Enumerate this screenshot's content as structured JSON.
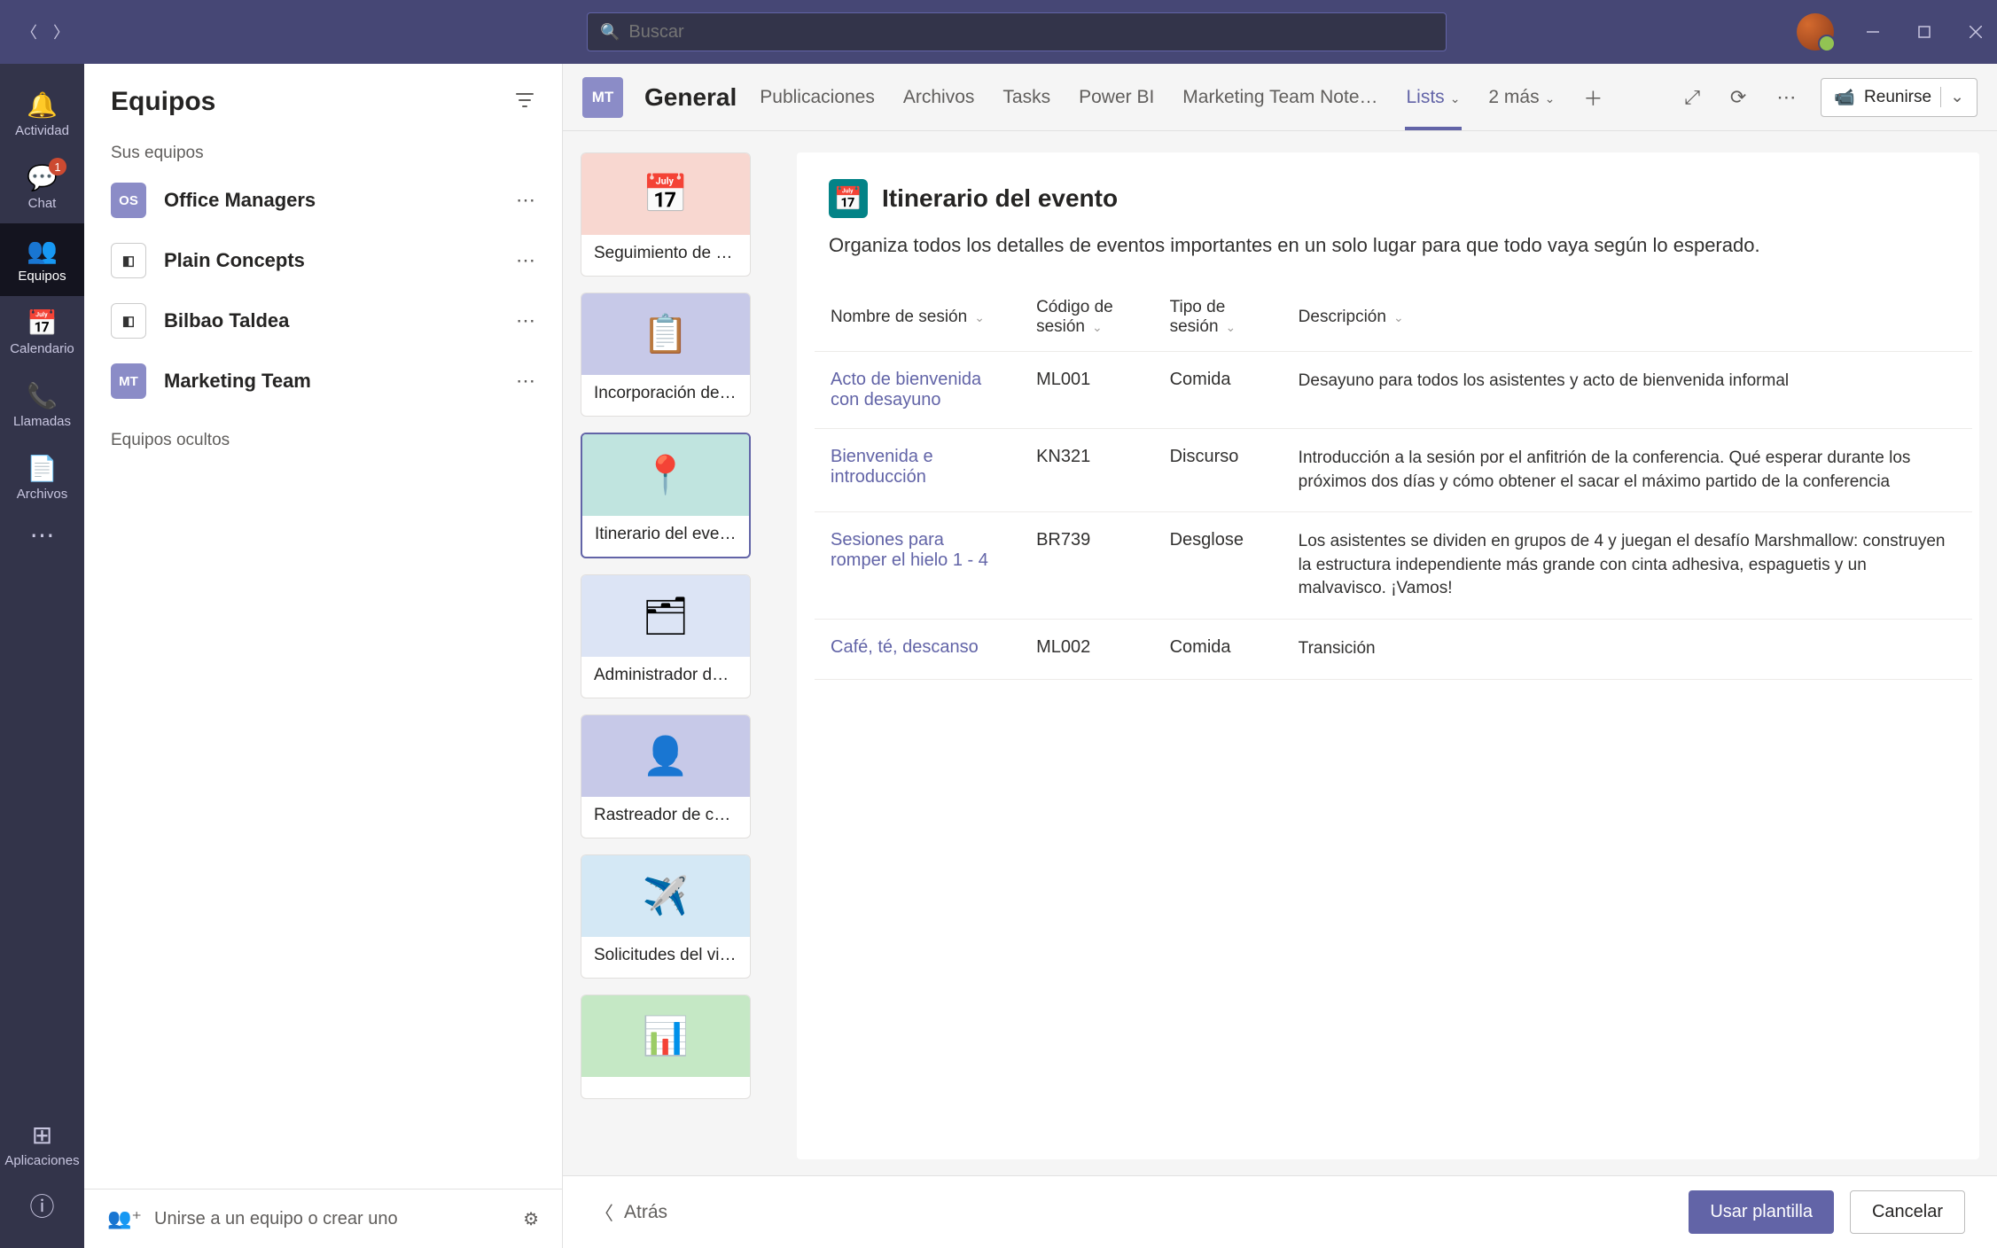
{
  "titlebar": {
    "search_placeholder": "Buscar"
  },
  "rail": {
    "items": [
      {
        "label": "Actividad",
        "icon": "🔔",
        "badge": null
      },
      {
        "label": "Chat",
        "icon": "💬",
        "badge": "1"
      },
      {
        "label": "Equipos",
        "icon": "👥",
        "badge": null
      },
      {
        "label": "Calendario",
        "icon": "📅",
        "badge": null
      },
      {
        "label": "Llamadas",
        "icon": "📞",
        "badge": null
      },
      {
        "label": "Archivos",
        "icon": "📄",
        "badge": null
      }
    ],
    "more": "⋯",
    "apps_label": "Aplicaciones"
  },
  "sidebar": {
    "title": "Equipos",
    "section_label": "Sus equipos",
    "teams": [
      {
        "initials": "OS",
        "name": "Office Managers",
        "bg": "#8b8cc7"
      },
      {
        "initials": "",
        "name": "Plain Concepts",
        "bg": "#ffffff"
      },
      {
        "initials": "",
        "name": "Bilbao Taldea",
        "bg": "#ffffff"
      },
      {
        "initials": "MT",
        "name": "Marketing Team",
        "bg": "#8b8cc7"
      }
    ],
    "hidden_label": "Equipos ocultos",
    "join_label": "Unirse a un equipo o crear uno"
  },
  "tabs": {
    "channel_initials": "MT",
    "channel_name": "General",
    "items": [
      {
        "label": "Publicaciones"
      },
      {
        "label": "Archivos"
      },
      {
        "label": "Tasks"
      },
      {
        "label": "Power BI"
      },
      {
        "label": "Marketing Team Note…"
      },
      {
        "label": "Lists",
        "active": true,
        "dropdown": true
      },
      {
        "label": "2 más",
        "dropdown": true
      }
    ],
    "meet_label": "Reunirse"
  },
  "templates": [
    {
      "label": "Seguimiento de …",
      "thumb_bg": "#f8d7d0",
      "emoji": "📅"
    },
    {
      "label": "Incorporación de …",
      "thumb_bg": "#c7c9e8",
      "emoji": "📋"
    },
    {
      "label": "Itinerario del eve…",
      "thumb_bg": "#c0e4df",
      "emoji": "📍",
      "selected": true
    },
    {
      "label": "Administrador de…",
      "thumb_bg": "#dce4f5",
      "emoji": "🗂"
    },
    {
      "label": "Rastreador de co…",
      "thumb_bg": "#c7c9e8",
      "emoji": "👤"
    },
    {
      "label": "Solicitudes del vi…",
      "thumb_bg": "#d4e8f5",
      "emoji": "✈️"
    },
    {
      "label": "",
      "thumb_bg": "#c5e8c5",
      "emoji": "📊"
    }
  ],
  "preview": {
    "title": "Itinerario del evento",
    "description": "Organiza todos los detalles de eventos importantes en un solo lugar para que todo vaya según lo esperado.",
    "columns": [
      "Nombre de sesión",
      "Código de sesión",
      "Tipo de sesión",
      "Descripción"
    ],
    "rows": [
      {
        "name": "Acto de bienvenida con desayuno",
        "code": "ML001",
        "type": "Comida",
        "desc": "Desayuno para todos los asistentes y acto de bienvenida informal"
      },
      {
        "name": "Bienvenida e introducción",
        "code": "KN321",
        "type": "Discurso",
        "desc": "Introducción a la sesión por el anfitrión de la conferencia. Qué esperar durante los próximos dos días y cómo obtener el sacar el máximo partido de la conferencia"
      },
      {
        "name": "Sesiones para romper el hielo 1 - 4",
        "code": "BR739",
        "type": "Desglose",
        "desc": "Los asistentes se dividen en grupos de 4 y juegan el desafío Marshmallow: construyen la estructura independiente más grande con cinta adhesiva, espaguetis y un malvavisco. ¡Vamos!"
      },
      {
        "name": "Café, té, descanso",
        "code": "ML002",
        "type": "Comida",
        "desc": "Transición"
      }
    ]
  },
  "footer": {
    "back_label": "Atrás",
    "use_label": "Usar plantilla",
    "cancel_label": "Cancelar"
  }
}
